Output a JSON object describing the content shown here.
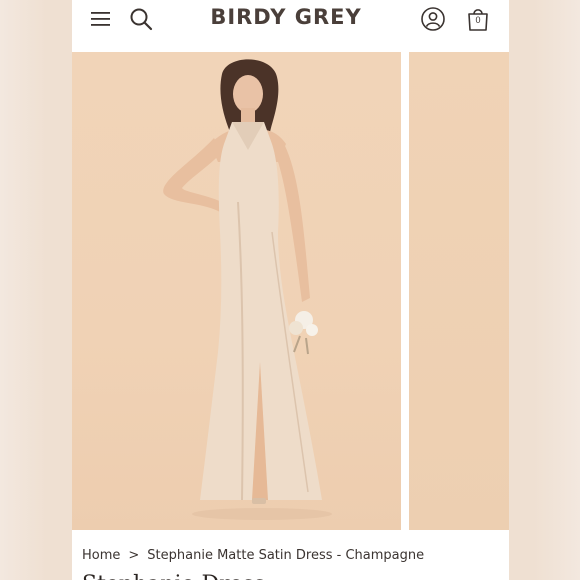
{
  "header": {
    "brand": "BIRDY GREY",
    "bag_count": "0"
  },
  "icons": {
    "menu": "menu-icon",
    "search": "search-icon",
    "account": "account-icon",
    "bag": "bag-icon"
  },
  "breadcrumb": {
    "home": "Home",
    "separator": ">",
    "current": "Stephanie Matte Satin Dress - Champagne"
  },
  "product": {
    "title": "Stephanie Dress"
  },
  "colors": {
    "backdrop": "#f0d2b5",
    "dress": "#ecd8c4",
    "brand_text": "#4a3f3a"
  }
}
